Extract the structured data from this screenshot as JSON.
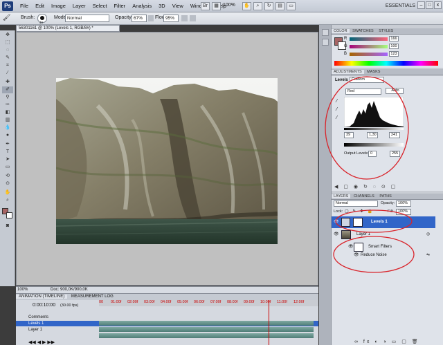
{
  "menubar": {
    "logo": "Ps",
    "menus": [
      "File",
      "Edit",
      "Image",
      "Layer",
      "Select",
      "Filter",
      "Analysis",
      "3D",
      "View",
      "Window",
      "Help"
    ],
    "zoom": "100%",
    "workspace": "ESSENTIALS",
    "win_min": "–",
    "win_max": "□",
    "win_close": "x"
  },
  "options": {
    "brush_label": "Brush:",
    "brush_size": "40",
    "mode_label": "Mode:",
    "mode_value": "Normal",
    "opacity_label": "Opacity:",
    "opacity_value": "67%",
    "flow_label": "Flow:",
    "flow_value": "95%"
  },
  "document": {
    "tab_title": "56301161 @ 100% (Levels 1, RGB/8#) *",
    "zoom": "100%",
    "doc_size": "Doc: 900,0K/900,0K"
  },
  "timeline": {
    "tabs": [
      "ANIMATION (TIMELINE)",
      "MEASUREMENT LOG"
    ],
    "time": "0:00:10:00",
    "fps": "(30.00 fps)",
    "ruler": [
      "00",
      "01:00f",
      "02:00f",
      "03:00f",
      "04:00f",
      "05:00f",
      "06:00f",
      "07:00f",
      "08:00f",
      "09:00f",
      "10:00f",
      "11:00f",
      "12:00f"
    ],
    "rows": [
      "Comments",
      "Levels 1",
      "Layer 1"
    ]
  },
  "color_panel": {
    "tabs": [
      "COLOR",
      "SWATCHES",
      "STYLES"
    ],
    "channels": [
      {
        "label": "R",
        "value": "166"
      },
      {
        "label": "G",
        "value": "100"
      },
      {
        "label": "B",
        "value": "123"
      }
    ],
    "fg_color": "#a66464"
  },
  "adjustments": {
    "tabs": [
      "ADJUSTMENTS",
      "MASKS"
    ],
    "title": "Levels",
    "preset": "Custom",
    "channel": "Red",
    "auto_label": "Auto",
    "input_black": "39",
    "input_gamma": "1,30",
    "input_white": "241",
    "output_label": "Output Levels:",
    "output_black": "0",
    "output_white": "255"
  },
  "layers": {
    "tabs": [
      "LAYERS",
      "CHANNELS",
      "PATHS"
    ],
    "blend_mode": "Normal",
    "opacity_label": "Opacity:",
    "opacity_value": "100%",
    "lock_label": "Lock:",
    "fill_label": "Fill:",
    "fill_value": "100%",
    "items": [
      {
        "name": "Levels 1",
        "selected": true
      },
      {
        "name": "Layer 1",
        "selected": false
      },
      {
        "name": "Smart Filters",
        "selected": false
      },
      {
        "name": "Reduce Noise",
        "selected": false
      }
    ]
  },
  "colors": {
    "selection": "#3165c8",
    "annotation": "#d9232a"
  }
}
